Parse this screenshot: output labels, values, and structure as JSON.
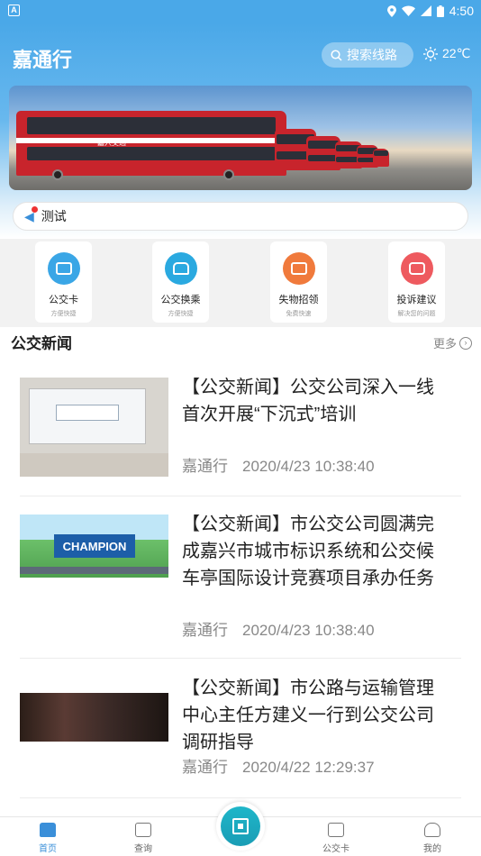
{
  "status_bar": {
    "time": "4:50"
  },
  "header": {
    "title": "嘉通行",
    "search_label": "搜索线路",
    "temperature": "22℃"
  },
  "notice": {
    "text": "测试"
  },
  "services": [
    {
      "label": "公交卡",
      "sub": "方便快捷",
      "color": "#3aa6e6"
    },
    {
      "label": "公交换乘",
      "sub": "方便快捷",
      "color": "#2aa9e0"
    },
    {
      "label": "失物招领",
      "sub": "免费快速",
      "color": "#f07a3c"
    },
    {
      "label": "投诉建议",
      "sub": "解决您的问题",
      "color": "#ee5a5f"
    }
  ],
  "news_section": {
    "title": "公交新闻",
    "more_label": "更多"
  },
  "news": [
    {
      "title": "【公交新闻】公交公司深入一线 首次开展“下沉式”培训",
      "source": "嘉通行",
      "time": "2020/4/23 10:38:40"
    },
    {
      "title": "【公交新闻】市公交公司圆满完成嘉兴市城市标识系统和公交候车亭国际设计竞赛项目承办任务",
      "source": "嘉通行",
      "time": "2020/4/23 10:38:40",
      "image_text": "CHAMPION"
    },
    {
      "title": "【公交新闻】市公路与运输管理中心主任方建义一行到公交公司调研指导",
      "source": "嘉通行",
      "time": "2020/4/22 12:29:37"
    }
  ],
  "tabbar": {
    "home": "首页",
    "query": "查询",
    "card": "公交卡",
    "mine": "我的"
  },
  "banner": {
    "bus_text": "嘉兴交通"
  }
}
